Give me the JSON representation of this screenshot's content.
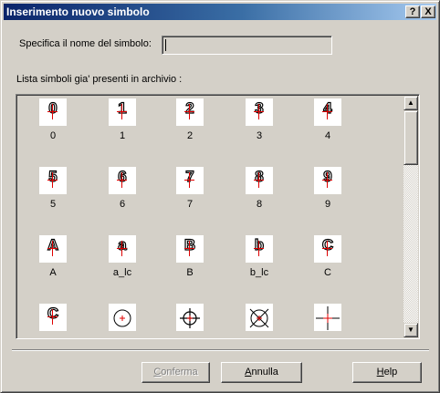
{
  "window": {
    "title": "Inserimento nuovo simbolo",
    "help_glyph": "?",
    "close_glyph": "X"
  },
  "form": {
    "name_label": "Specifica il nome del simbolo:",
    "name_value": "",
    "list_label": "Lista simboli gia' presenti in archivio :"
  },
  "symbols": [
    {
      "glyph": "0",
      "name": "0"
    },
    {
      "glyph": "1",
      "name": "1"
    },
    {
      "glyph": "2",
      "name": "2"
    },
    {
      "glyph": "3",
      "name": "3"
    },
    {
      "glyph": "4",
      "name": "4"
    },
    {
      "glyph": "5",
      "name": "5"
    },
    {
      "glyph": "6",
      "name": "6"
    },
    {
      "glyph": "7",
      "name": "7"
    },
    {
      "glyph": "8",
      "name": "8"
    },
    {
      "glyph": "9",
      "name": "9"
    },
    {
      "glyph": "A",
      "name": "A"
    },
    {
      "glyph": "a",
      "name": "a_lc"
    },
    {
      "glyph": "B",
      "name": "B"
    },
    {
      "glyph": "b",
      "name": "b_lc"
    },
    {
      "glyph": "C",
      "name": "C"
    },
    {
      "glyph": "C",
      "name": ""
    },
    {
      "glyph": "",
      "name": ""
    },
    {
      "glyph": "",
      "name": ""
    },
    {
      "glyph": "",
      "name": ""
    },
    {
      "glyph": "",
      "name": ""
    }
  ],
  "scroll": {
    "up_glyph": "▲",
    "down_glyph": "▼"
  },
  "buttons": {
    "confirm": {
      "prefix": "",
      "underline": "C",
      "rest": "onferma"
    },
    "cancel": {
      "prefix": "",
      "underline": "A",
      "rest": "nnulla"
    },
    "help": {
      "prefix": "",
      "underline": "H",
      "rest": "elp"
    }
  }
}
